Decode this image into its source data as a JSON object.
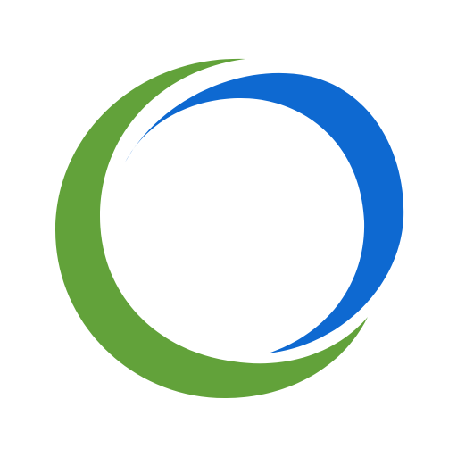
{
  "logo": {
    "icon": "swoosh-ring-logo-icon",
    "background_color": "#ffffff",
    "green_arc_color": "#62a23a",
    "blue_arc_color": "#0e69d1"
  }
}
